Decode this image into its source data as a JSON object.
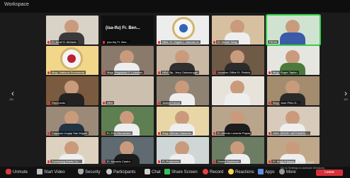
{
  "window": {
    "title": "Workspace"
  },
  "navigation": {
    "left_arrow": "‹",
    "right_arrow": "›",
    "left_page": "1/5",
    "right_page": "1/5"
  },
  "participants": [
    "Fr. Arnel S. Aliviado",
    "(isa-ifu) Fr. Ben...",
    "NBA: Fr. Virgilio L. Antonio Jr.",
    "Fr. Nestor Dilag",
    "PEVN",
    "Msgr. National Secretariat",
    "Msgr. Regalado D. Lomotan",
    "NBA: Bp. Jerry Cabusongan",
    "Vocation Office Fr. Patrick",
    "Msgr. Roger Taplen",
    "Raymundo",
    "NBA",
    "Joseph Limon",
    "",
    "Msgr. Jose Pinto D...",
    "Cagayan Lingap San Miguel",
    "Fr. Pau Hernandez",
    "Msgr. Alfredo Gabarren",
    "Fr. Alfredo Llorente Papas",
    "AMA: MSGR. NATHANIEL...",
    "Zamboang Abello Co...",
    "Fr. Macario Castro",
    "Fr. Prudencio",
    "District Anastacio",
    "Fr. Mark A. Amor"
  ],
  "active_speaker_name_text": "(isa-ifu) Fr. Ben...",
  "toolbar": {
    "mute": "Unmute",
    "video": "Start Video",
    "security": "Security",
    "participants": "Participants",
    "chat": "Chat",
    "share": "Share Screen",
    "record": "Record",
    "reactions": "Reactions",
    "apps": "Apps",
    "more": "More",
    "leave": "Leave"
  },
  "watermark": {
    "title": "Activate Windows",
    "subtitle": "Go to Settings to activate Windows."
  },
  "colors": {
    "active_border": "#35d04a",
    "muted_mic": "#d83b3b",
    "leave": "#d8303a"
  }
}
